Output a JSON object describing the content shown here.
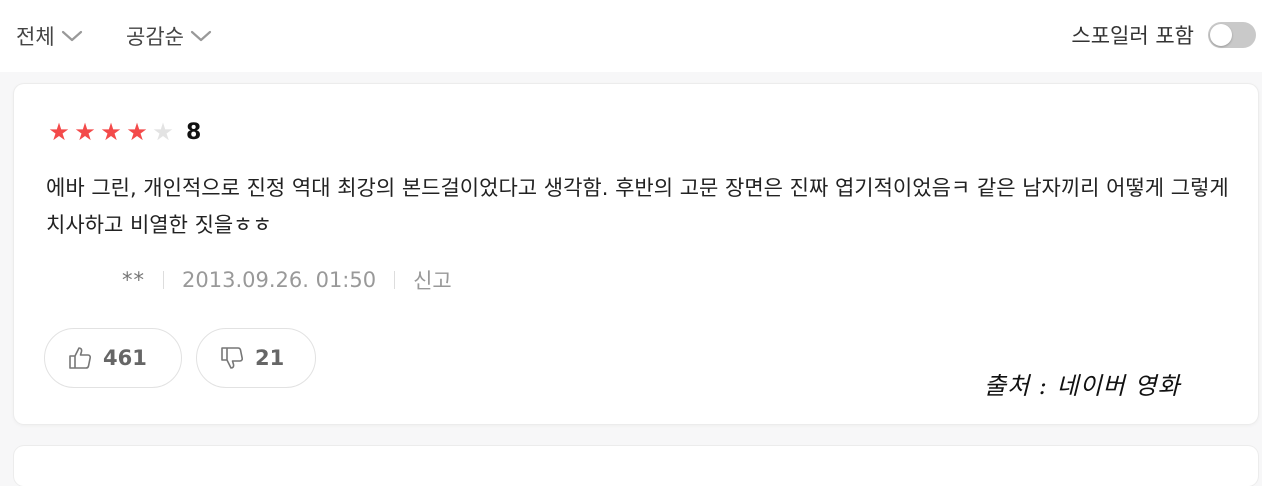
{
  "filters": {
    "all_label": "전체",
    "sort_label": "공감순"
  },
  "spoiler": {
    "label": "스포일러 포함",
    "enabled": false
  },
  "review": {
    "stars_filled": 4,
    "stars_total": 5,
    "score": "8",
    "text": "에바 그린, 개인적으로 진정 역대 최강의 본드걸이었다고 생각함. 후반의 고문 장면은 진짜 엽기적이었음ㅋ 같은 남자끼리 어떻게 그렇게 치사하고 비열한 짓을ㅎㅎ",
    "author": "**",
    "date": "2013.09.26. 01:50",
    "report_label": "신고",
    "likes": "461",
    "dislikes": "21"
  },
  "source_label": "출처 : 네이버 영화",
  "colors": {
    "star_on": "#f34a4a",
    "star_off": "#e3e3e3",
    "toggle_off": "#c9c9c9"
  },
  "icons": {
    "filter_chevron": "chevron-down-icon",
    "like": "thumbs-up-icon",
    "dislike": "thumbs-down-icon"
  }
}
